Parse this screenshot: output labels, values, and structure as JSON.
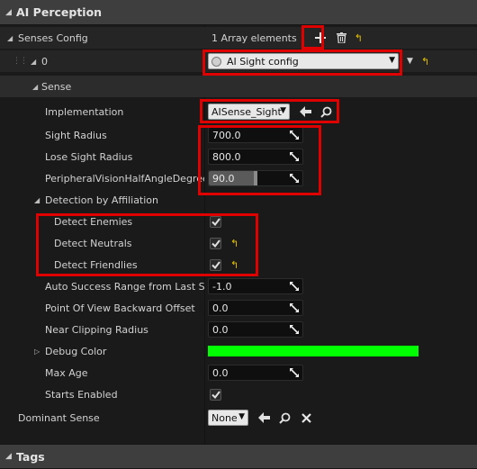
{
  "header": {
    "title": "AI Perception"
  },
  "senses_config": {
    "label": "Senses Config",
    "count_label": "1 Array elements",
    "index_label": "0",
    "element_value": "AI Sight config",
    "sense_label": "Sense",
    "implementation": {
      "label": "Implementation",
      "value": "AISense_Sight"
    },
    "sight_radius": {
      "label": "Sight Radius",
      "value": "700.0"
    },
    "lose_sight_radius": {
      "label": "Lose Sight Radius",
      "value": "800.0"
    },
    "peripheral": {
      "label": "PeripheralVisionHalfAngleDegrees",
      "value": "90.0",
      "fraction": 0.5
    },
    "affiliation": {
      "label": "Detection by Affiliation",
      "enemies": {
        "label": "Detect Enemies",
        "checked": true
      },
      "neutrals": {
        "label": "Detect Neutrals",
        "checked": true
      },
      "friendlies": {
        "label": "Detect Friendlies",
        "checked": true
      }
    },
    "auto_success": {
      "label": "Auto Success Range from Last Seen",
      "value": "-1.0"
    },
    "pov_offset": {
      "label": "Point Of View Backward Offset",
      "value": "0.0"
    },
    "near_clip": {
      "label": "Near Clipping Radius",
      "value": "0.0"
    },
    "debug_color": {
      "label": "Debug Color",
      "color": "#00ff00"
    },
    "max_age": {
      "label": "Max Age",
      "value": "0.0"
    },
    "starts_enabled": {
      "label": "Starts Enabled",
      "checked": true
    }
  },
  "dominant_sense": {
    "label": "Dominant Sense",
    "value": "None"
  },
  "tags_header": {
    "title": "Tags"
  },
  "colors": {
    "highlight": "#e00000",
    "panel": "#1a1a1a",
    "header": "#3e3e3e",
    "reset_arrow": "#e6c200"
  }
}
